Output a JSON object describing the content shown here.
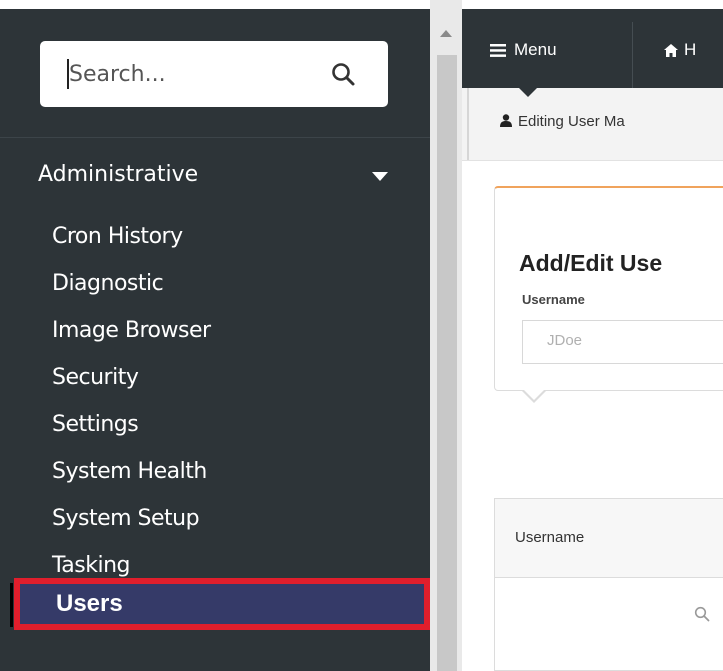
{
  "sidebar": {
    "search": {
      "placeholder": "Search..."
    },
    "section": {
      "label": "Administrative"
    },
    "items": [
      {
        "label": "Cron History"
      },
      {
        "label": "Diagnostic"
      },
      {
        "label": "Image Browser"
      },
      {
        "label": "Security"
      },
      {
        "label": "Settings"
      },
      {
        "label": "System Health"
      },
      {
        "label": "System Setup"
      },
      {
        "label": "Tasking"
      }
    ],
    "active_item": {
      "label": "Users"
    }
  },
  "topbar": {
    "menu_label": "Menu",
    "home_label": "H",
    "menu_icon": "bars-icon",
    "home_icon": "home-icon"
  },
  "breadcrumb": {
    "text": "Editing User Ma",
    "icon": "user-icon"
  },
  "form": {
    "title": "Add/Edit Use",
    "username_label": "Username",
    "username_placeholder": "JDoe"
  },
  "table": {
    "columns": [
      "Username"
    ],
    "filter_icon": "search-icon"
  },
  "colors": {
    "sidebar_bg": "#2d3438",
    "active_bg": "#353a68",
    "highlight_border": "#e01e2c",
    "card_accent": "#f0a35c"
  }
}
